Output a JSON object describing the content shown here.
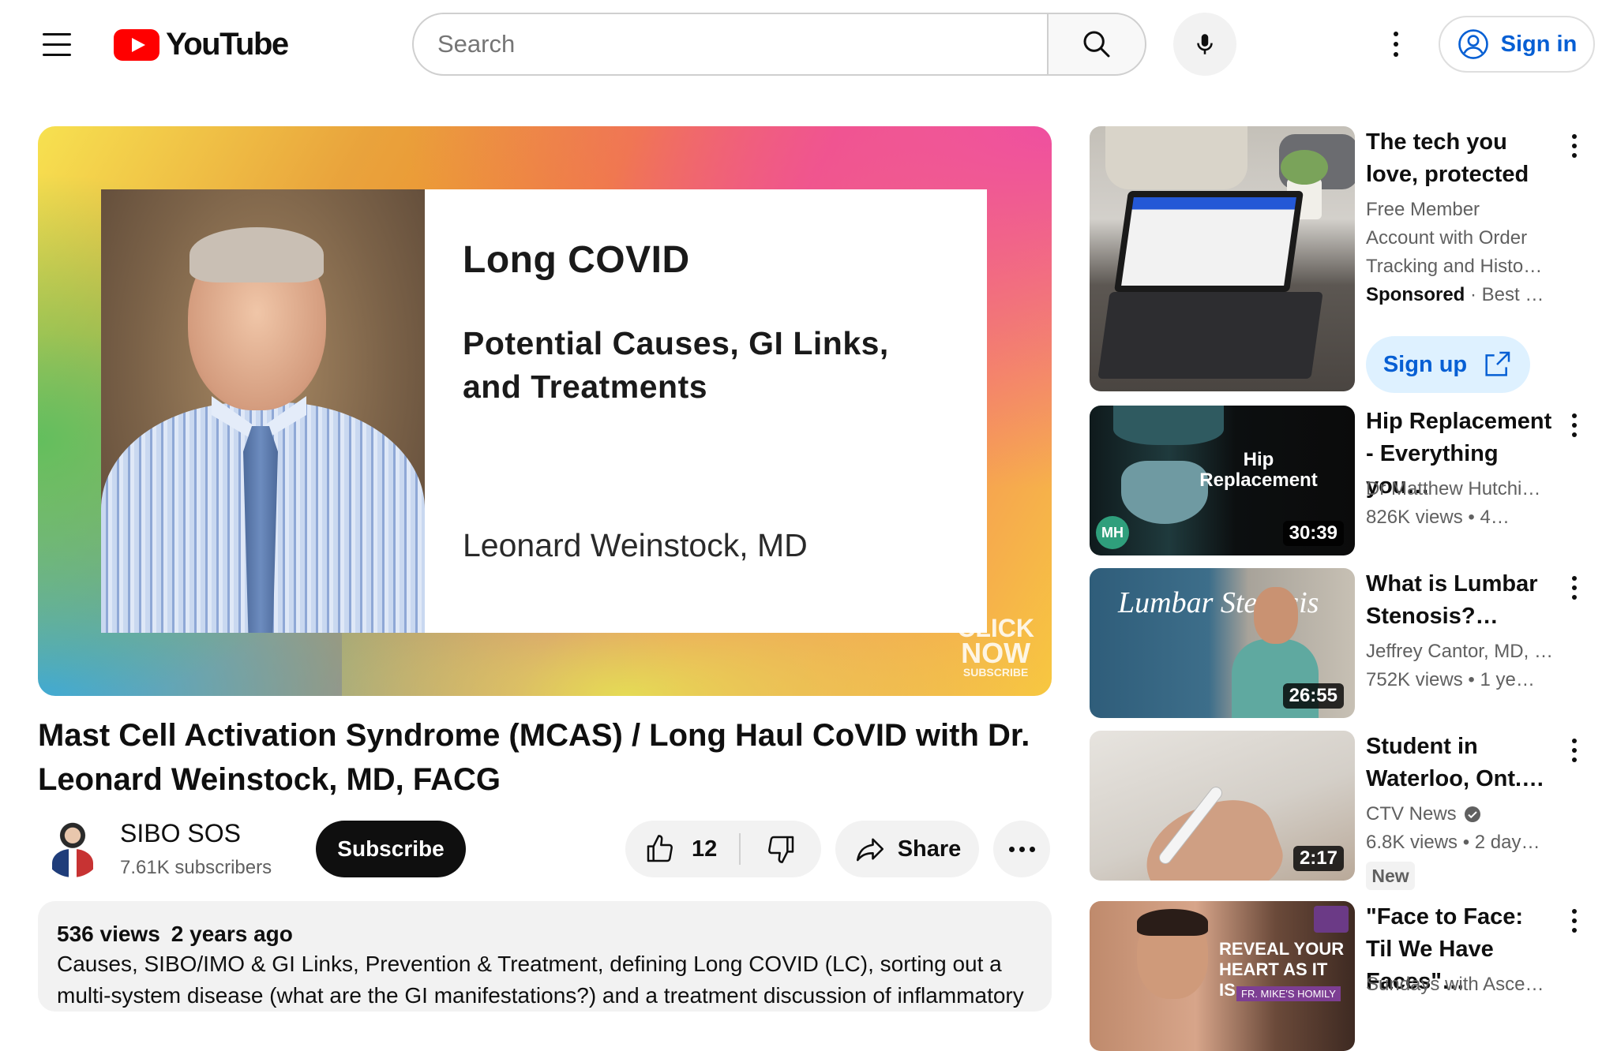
{
  "header": {
    "logo_text": "YouTube",
    "search_placeholder": "Search",
    "search_value": "",
    "sign_in_label": "Sign in"
  },
  "player": {
    "slide_title": "Long COVID",
    "slide_subtitle": "Potential Causes, GI Links, and Treatments",
    "slide_author": "Leonard Weinstock, MD",
    "watermark": [
      "CLICK",
      "NOW",
      "SUBSCRIBE"
    ]
  },
  "video": {
    "title": "Mast Cell Activation Syndrome (MCAS) / Long Haul CoVID with Dr. Leonard Weinstock, MD, FACG",
    "channel_name": "SIBO SOS",
    "subscribers": "7.61K subscribers",
    "subscribe_label": "Subscribe",
    "like_count": "12",
    "share_label": "Share",
    "views": "536 views",
    "age": "2 years ago",
    "description": "Causes, SIBO/IMO & GI Links, Prevention & Treatment, defining Long COVID (LC), sorting out a multi-system disease (what are the GI manifestations?) and a treatment discussion of inflammatory pathways."
  },
  "sidebar": {
    "ad": {
      "title": "The tech you love, protected",
      "description": "Free Member Account with Order Tracking and Histo…",
      "sponsored_label": "Sponsored",
      "advertiser": "Best …",
      "cta_label": "Sign up"
    },
    "recommendations": [
      {
        "title": "Hip Replacement - Everything you…",
        "channel": "Dr Matthew Hutchi…",
        "stats": "826K views  • 4…",
        "duration": "30:39",
        "thumb_text": "Hip Replacement",
        "thumb_badge": "MH"
      },
      {
        "title": "What is Lumbar Stenosis?…",
        "channel": "Jeffrey Cantor, MD, …",
        "stats": "752K views  • 1 ye…",
        "duration": "26:55",
        "thumb_text": "Lumbar Stenosis"
      },
      {
        "title": "Student in Waterloo, Ont.…",
        "channel": "CTV News",
        "verified": true,
        "stats": "6.8K views  • 2 day…",
        "duration": "2:17",
        "badge": "New"
      },
      {
        "title": "\"Face to Face: Til We Have Faces\"…",
        "channel": "Sundays with Asce…",
        "thumb_text": "REVEAL YOUR HEART AS IT IS",
        "thumb_subtext": "FR. MIKE'S HOMILY"
      }
    ]
  },
  "colors": {
    "brand_red": "#ff0000",
    "link_blue": "#065fd4",
    "signup_bg": "#def1ff",
    "chip_bg": "#f2f2f2"
  },
  "icons": [
    "menu-icon",
    "youtube-logo-icon",
    "search-icon",
    "microphone-icon",
    "more-vert-icon",
    "account-circle-icon",
    "thumb-up-icon",
    "thumb-down-icon",
    "share-icon",
    "more-horiz-icon",
    "external-link-icon",
    "verified-badge-icon"
  ]
}
